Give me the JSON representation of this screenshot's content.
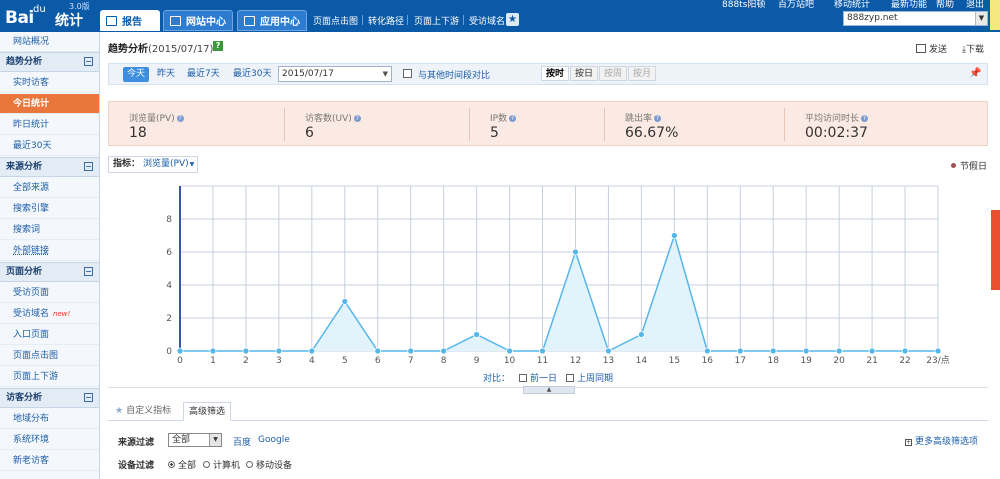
{
  "logo": {
    "brand": "Bai",
    "paw": "du",
    "product": "统计",
    "version": "3.0版"
  },
  "header": {
    "tabs": [
      {
        "label": "报告"
      },
      {
        "label": "网站中心"
      },
      {
        "label": "应用中心"
      }
    ],
    "links": [
      "页面点击图",
      "转化路径",
      "页面上下游",
      "受访域名"
    ],
    "right_links": [
      "888ts阳顿",
      "百万站吧",
      "移动统计",
      "最新功能",
      "帮助",
      "退出"
    ],
    "site": "888zyp.net"
  },
  "sidebar": {
    "top_item": "网站概况",
    "groups": [
      {
        "title": "趋势分析",
        "items": [
          "实时访客",
          "今日统计",
          "昨日统计",
          "最近30天"
        ]
      },
      {
        "title": "来源分析",
        "items": [
          "全部来源",
          "搜索引擎",
          "搜索词",
          "外部链接"
        ]
      },
      {
        "title": "页面分析",
        "items": [
          "受访页面",
          "受访域名",
          "入口页面",
          "页面点击图",
          "页面上下游"
        ]
      },
      {
        "title": "访客分析",
        "items": [
          "地域分布",
          "系统环境",
          "新老访客"
        ]
      }
    ],
    "new_badge": "new!",
    "collapse_symbol": "⊟"
  },
  "main": {
    "title": "趋势分析",
    "title_date": "(2015/07/17)",
    "help": "?",
    "send_label": "发送",
    "download_label": "下载"
  },
  "datebar": {
    "quick": [
      "今天",
      "昨天",
      "最近7天",
      "最近30天"
    ],
    "date_value": "2015/07/17",
    "compare_label": "与其他时间段对比",
    "granularity": [
      "按时",
      "按日",
      "按周",
      "按月"
    ]
  },
  "metrics": [
    {
      "label": "浏览量(PV)",
      "value": "18"
    },
    {
      "label": "访客数(UV)",
      "value": "6"
    },
    {
      "label": "IP数",
      "value": "5"
    },
    {
      "label": "跳出率",
      "value": "66.67%"
    },
    {
      "label": "平均访问时长",
      "value": "00:02:37"
    }
  ],
  "metric_select": {
    "label": "指标：",
    "value": "浏览量(PV)"
  },
  "holiday_label": "节假日",
  "chart_data": {
    "type": "area",
    "series": [
      {
        "name": "浏览量(PV)",
        "values": [
          0,
          0,
          0,
          0,
          0,
          3,
          0,
          0,
          0,
          1,
          0,
          0,
          6,
          0,
          1,
          7,
          0,
          0,
          0,
          0,
          0,
          0,
          0,
          0
        ]
      }
    ],
    "x_ticks": [
      "0",
      "1",
      "2",
      "3",
      "4",
      "5",
      "6",
      "7",
      "8",
      "9",
      "10",
      "11",
      "12",
      "13",
      "14",
      "15",
      "16",
      "17",
      "18",
      "19",
      "20",
      "21",
      "22",
      "23/点"
    ],
    "y_ticks": [
      "0",
      "2",
      "4",
      "6",
      "8"
    ],
    "ylim": [
      0,
      10
    ],
    "grid": true,
    "colors": {
      "line": "#55b6ea",
      "fill": "#e3f3fc",
      "grid": "#c6cfe0",
      "axis": "#3657a8"
    }
  },
  "compare": {
    "label": "对比：",
    "options": [
      "前一日",
      "上周同期"
    ]
  },
  "collapse_arrow": "▲",
  "filter": {
    "tabs": [
      "自定义指标",
      "高级筛选"
    ],
    "source_label": "来源过滤",
    "source_value": "全部",
    "source_links": [
      "百度",
      "Google"
    ],
    "device_label": "设备过滤",
    "device_options": [
      "全部",
      "计算机",
      "移动设备"
    ],
    "more_label": "更多高级筛选项"
  }
}
